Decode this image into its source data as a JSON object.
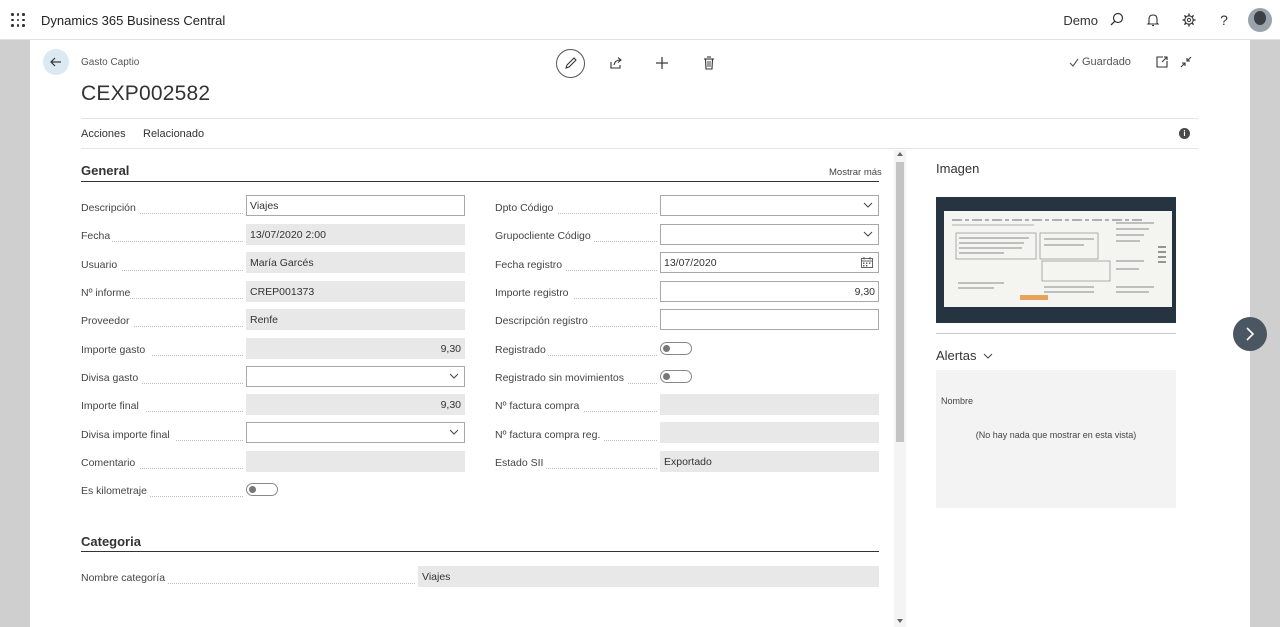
{
  "app": {
    "name": "Dynamics 365 Business Central",
    "company": "Demo"
  },
  "page": {
    "caption": "Gasto Captio",
    "title": "CEXP002582",
    "status": "Guardado",
    "menu": [
      "Acciones",
      "Relacionado"
    ]
  },
  "general": {
    "title": "General",
    "show_more": "Mostrar más",
    "left": [
      {
        "label": "Descripción",
        "value": "Viajes"
      },
      {
        "label": "Fecha",
        "value": "13/07/2020 2:00"
      },
      {
        "label": "Usuario",
        "value": "María Garcés"
      },
      {
        "label": "Nº informe",
        "value": "CREP001373"
      },
      {
        "label": "Proveedor",
        "value": "Renfe"
      },
      {
        "label": "Importe gasto",
        "value": "9,30"
      },
      {
        "label": "Divisa gasto",
        "value": ""
      },
      {
        "label": "Importe final",
        "value": "9,30"
      },
      {
        "label": "Divisa importe final",
        "value": ""
      },
      {
        "label": "Comentario",
        "value": ""
      },
      {
        "label": "Es kilometraje",
        "value": "No"
      }
    ],
    "right": [
      {
        "label": "Dpto Código",
        "value": ""
      },
      {
        "label": "Grupocliente Código",
        "value": ""
      },
      {
        "label": "Fecha registro",
        "value": "13/07/2020"
      },
      {
        "label": "Importe registro",
        "value": "9,30"
      },
      {
        "label": "Descripción registro",
        "value": ""
      },
      {
        "label": "Registrado",
        "value": "No"
      },
      {
        "label": "Registrado sin movimientos",
        "value": "No"
      },
      {
        "label": "Nº factura compra",
        "value": ""
      },
      {
        "label": "Nº factura compra reg.",
        "value": ""
      },
      {
        "label": "Estado SII",
        "value": "Exportado"
      }
    ]
  },
  "categoria": {
    "title": "Categoria",
    "fields": [
      {
        "label": "Nombre categoría",
        "value": "Viajes"
      }
    ]
  },
  "factbox": {
    "image_title": "Imagen",
    "alerts_title": "Alertas",
    "alerts_column": "Nombre",
    "alerts_empty": "(No hay nada que mostrar en esta vista)"
  },
  "colors": {
    "accent": "#dbe9f2",
    "header_bg": "#ffffff",
    "readonly_bg": "#e8e8e8"
  }
}
